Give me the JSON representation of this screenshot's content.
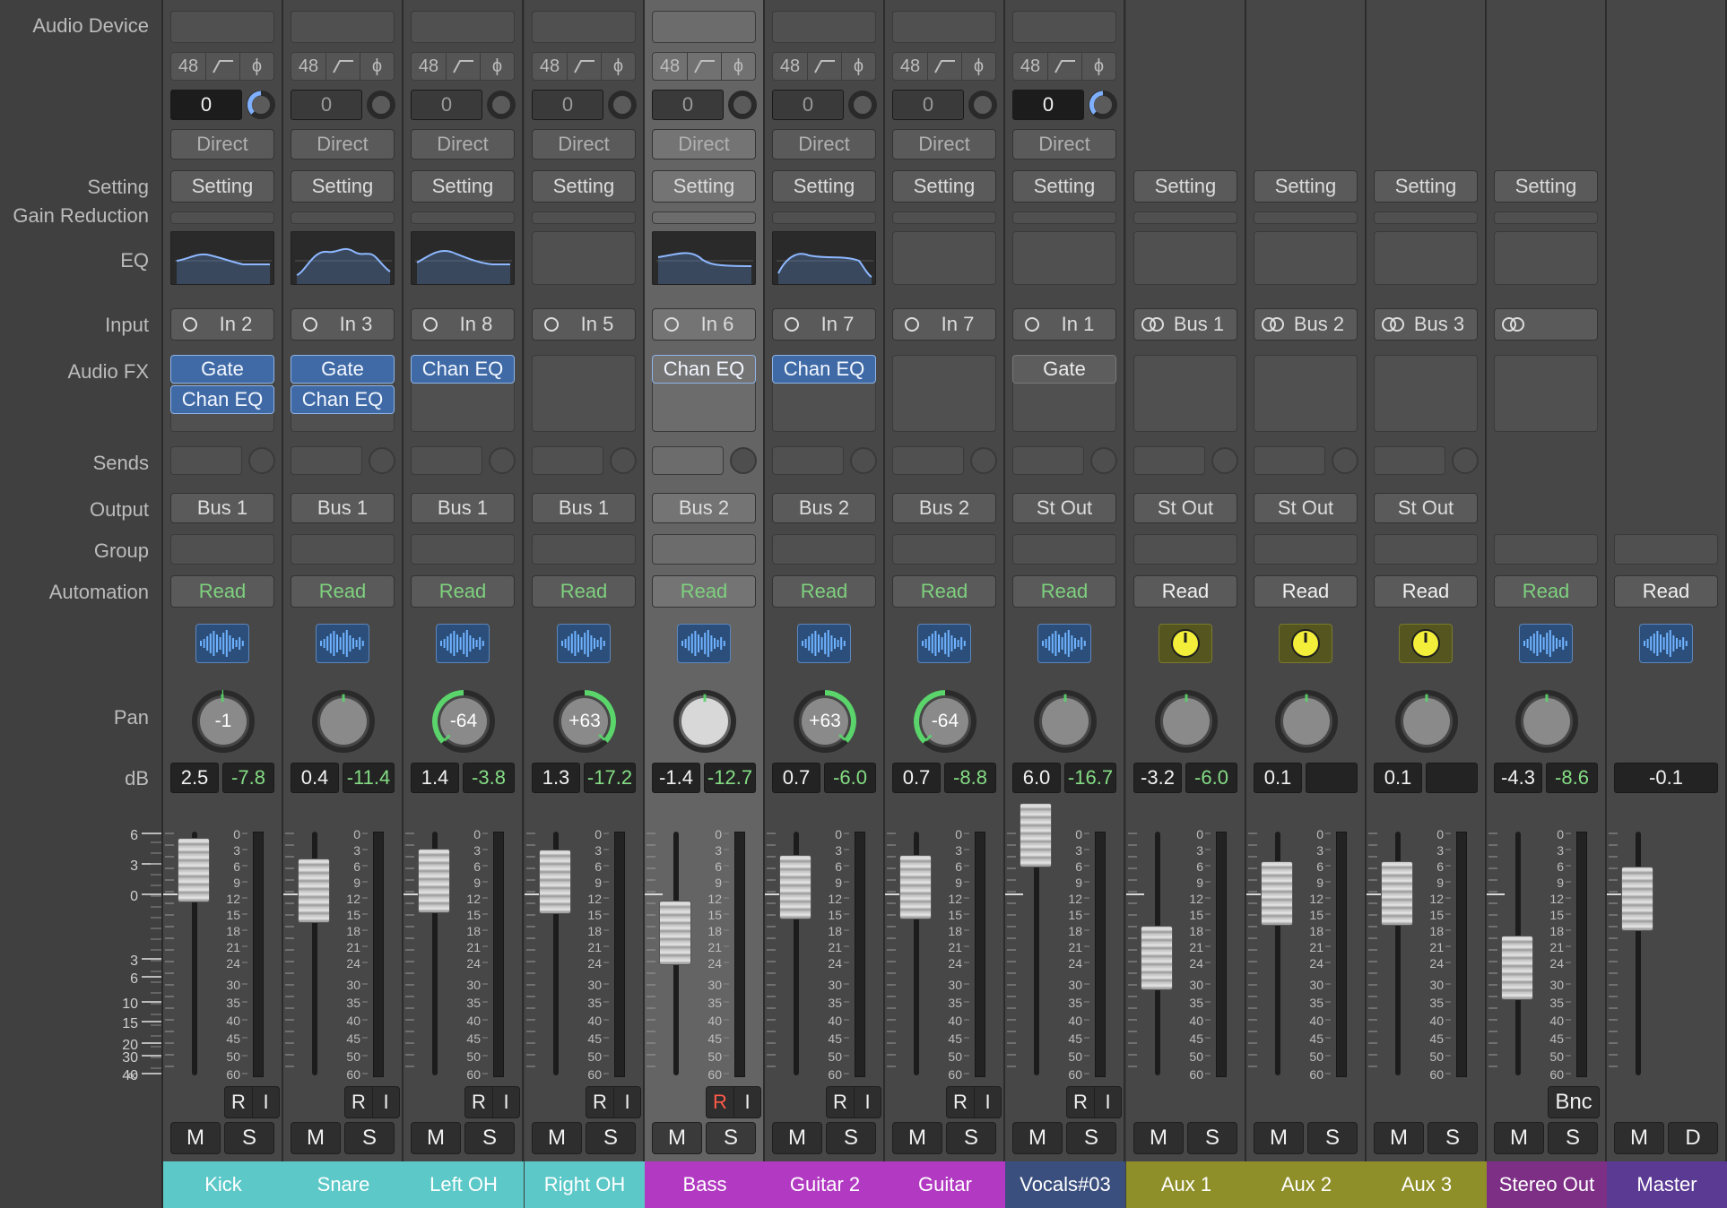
{
  "row_labels": {
    "audio_device": "Audio Device",
    "setting": "Setting",
    "gain_reduction": "Gain Reduction",
    "eq": "EQ",
    "input": "Input",
    "audio_fx": "Audio FX",
    "sends": "Sends",
    "output": "Output",
    "group": "Group",
    "automation": "Automation",
    "pan": "Pan",
    "db": "dB"
  },
  "left_scale": [
    "6",
    "3",
    "0",
    "3",
    "6",
    "10",
    "15",
    "20",
    "30",
    "40",
    "∞"
  ],
  "meter_scale": [
    "0",
    "3",
    "6",
    "9",
    "12",
    "15",
    "18",
    "21",
    "24",
    "30",
    "35",
    "40",
    "45",
    "50",
    "60"
  ],
  "common": {
    "sample_rate": "48",
    "direct_label": "Direct",
    "setting_label": "Setting",
    "mute": "M",
    "solo": "S",
    "dim": "D",
    "record": "R",
    "input_monitor": "I",
    "bounce": "Bnc"
  },
  "colors": {
    "cyan": "#5cc8c8",
    "magenta": "#b23ac2",
    "blue": "#3a4f7e",
    "olive": "#8f8f2a",
    "purple": "#7d2f86",
    "violet": "#5b3a94"
  },
  "strips": [
    {
      "name": "Kick",
      "color": "#5cc8c8",
      "input": "In 2",
      "input_icon": "mono",
      "gain": "0",
      "direct": true,
      "eq": true,
      "fx": [
        "Gate",
        "Chan EQ"
      ],
      "fx_style": "blue",
      "output": "Bus 1",
      "automation": "Read",
      "icon": "waveform-icon",
      "pan": "-1",
      "pan_value": -1,
      "db_value": "2.5",
      "db_peak": "-7.8",
      "fader": 2.5,
      "ri": true,
      "gain_knob_active": true
    },
    {
      "name": "Snare",
      "color": "#5cc8c8",
      "input": "In 3",
      "input_icon": "mono",
      "gain": "0",
      "direct": true,
      "eq": true,
      "fx": [
        "Gate",
        "Chan EQ"
      ],
      "fx_style": "blue",
      "output": "Bus 1",
      "automation": "Read",
      "icon": "waveform-icon",
      "pan": "",
      "pan_value": 0,
      "db_value": "0.4",
      "db_peak": "-11.4",
      "fader": 0.4,
      "ri": true
    },
    {
      "name": "Left OH",
      "color": "#5cc8c8",
      "input": "In 8",
      "input_icon": "mono",
      "gain": "0",
      "direct": true,
      "eq": true,
      "fx": [
        "Chan EQ"
      ],
      "fx_style": "blue",
      "output": "Bus 1",
      "automation": "Read",
      "icon": "waveform-icon",
      "pan": "-64",
      "pan_value": -64,
      "db_value": "1.4",
      "db_peak": "-3.8",
      "fader": 1.4,
      "ri": true
    },
    {
      "name": "Right OH",
      "color": "#5cc8c8",
      "input": "In 5",
      "input_icon": "mono",
      "gain": "0",
      "direct": true,
      "eq": false,
      "fx": [],
      "fx_style": "blue",
      "output": "Bus 1",
      "automation": "Read",
      "icon": "waveform-icon",
      "pan": "+63",
      "pan_value": 63,
      "db_value": "1.3",
      "db_peak": "-17.2",
      "fader": 1.3,
      "ri": true
    },
    {
      "name": "Bass",
      "color": "#b23ac2",
      "input": "In 6",
      "input_icon": "mono",
      "gain": "0",
      "direct": true,
      "eq": true,
      "fx": [
        "Chan EQ"
      ],
      "fx_style": "blue",
      "output": "Bus 2",
      "automation": "Read",
      "icon": "waveform-icon",
      "pan": "",
      "pan_value": 0,
      "db_value": "-1.4",
      "db_peak": "-12.7",
      "fader": -1.4,
      "ri": true,
      "selected": true,
      "record_armed": true
    },
    {
      "name": "Guitar 2",
      "color": "#b23ac2",
      "input": "In 7",
      "input_icon": "mono",
      "gain": "0",
      "direct": true,
      "eq": true,
      "fx": [
        "Chan EQ"
      ],
      "fx_style": "blue",
      "output": "Bus 2",
      "automation": "Read",
      "icon": "waveform-icon",
      "pan": "+63",
      "pan_value": 63,
      "db_value": "0.7",
      "db_peak": "-6.0",
      "fader": 0.7,
      "ri": true
    },
    {
      "name": "Guitar",
      "color": "#b23ac2",
      "input": "In 7",
      "input_icon": "mono",
      "gain": "0",
      "direct": true,
      "eq": false,
      "fx": [],
      "fx_style": "blue",
      "output": "Bus 2",
      "automation": "Read",
      "icon": "waveform-icon",
      "pan": "-64",
      "pan_value": -64,
      "db_value": "0.7",
      "db_peak": "-8.8",
      "fader": 0.7,
      "ri": true
    },
    {
      "name": "Vocals#03",
      "color": "#3a4f7e",
      "input": "In 1",
      "input_icon": "mono",
      "gain": "0",
      "direct": true,
      "eq": false,
      "fx": [
        "Gate"
      ],
      "fx_style": "grey",
      "output": "St Out",
      "automation": "Read",
      "icon": "waveform-icon",
      "pan": "",
      "pan_value": 0,
      "db_value": "6.0",
      "db_peak": "-16.7",
      "fader": 6.0,
      "ri": true,
      "gain_knob_active": true
    },
    {
      "name": "Aux 1",
      "color": "#8f8f2a",
      "input": "Bus 1",
      "input_icon": "stereo",
      "aux": true,
      "eq": false,
      "fx": [],
      "output": "St Out",
      "automation": "Read",
      "automation_white": true,
      "icon": "aux-icon",
      "pan": "",
      "pan_value": 0,
      "db_value": "-3.2",
      "db_peak": "-6.0",
      "fader": -3.2,
      "ri": false
    },
    {
      "name": "Aux 2",
      "color": "#8f8f2a",
      "input": "Bus 2",
      "input_icon": "stereo",
      "aux": true,
      "eq": false,
      "fx": [],
      "output": "St Out",
      "automation": "Read",
      "automation_white": true,
      "icon": "aux-icon",
      "pan": "",
      "pan_value": 0,
      "db_value": "0.1",
      "db_peak": "",
      "fader": 0.1,
      "ri": false
    },
    {
      "name": "Aux 3",
      "color": "#8f8f2a",
      "input": "Bus 3",
      "input_icon": "stereo",
      "aux": true,
      "eq": false,
      "fx": [],
      "output": "St Out",
      "automation": "Read",
      "automation_white": true,
      "icon": "aux-icon",
      "pan": "",
      "pan_value": 0,
      "db_value": "0.1",
      "db_peak": "",
      "fader": 0.1,
      "ri": false
    },
    {
      "name": "Stereo Out",
      "color": "#7d2f86",
      "input": "",
      "input_icon": "stereo",
      "aux": true,
      "eq": false,
      "fx": [],
      "output": "",
      "automation": "Read",
      "icon": "waveform-icon",
      "pan": "",
      "pan_value": 0,
      "db_value": "-4.3",
      "db_peak": "-8.6",
      "fader": -4.3,
      "ri": false,
      "bnc": true,
      "no_sends": true
    },
    {
      "name": "Master",
      "color": "#5b3a94",
      "master": true,
      "automation": "Read",
      "automation_white": true,
      "icon": "waveform-icon",
      "db_value": "-0.1",
      "fader": -0.1
    }
  ]
}
